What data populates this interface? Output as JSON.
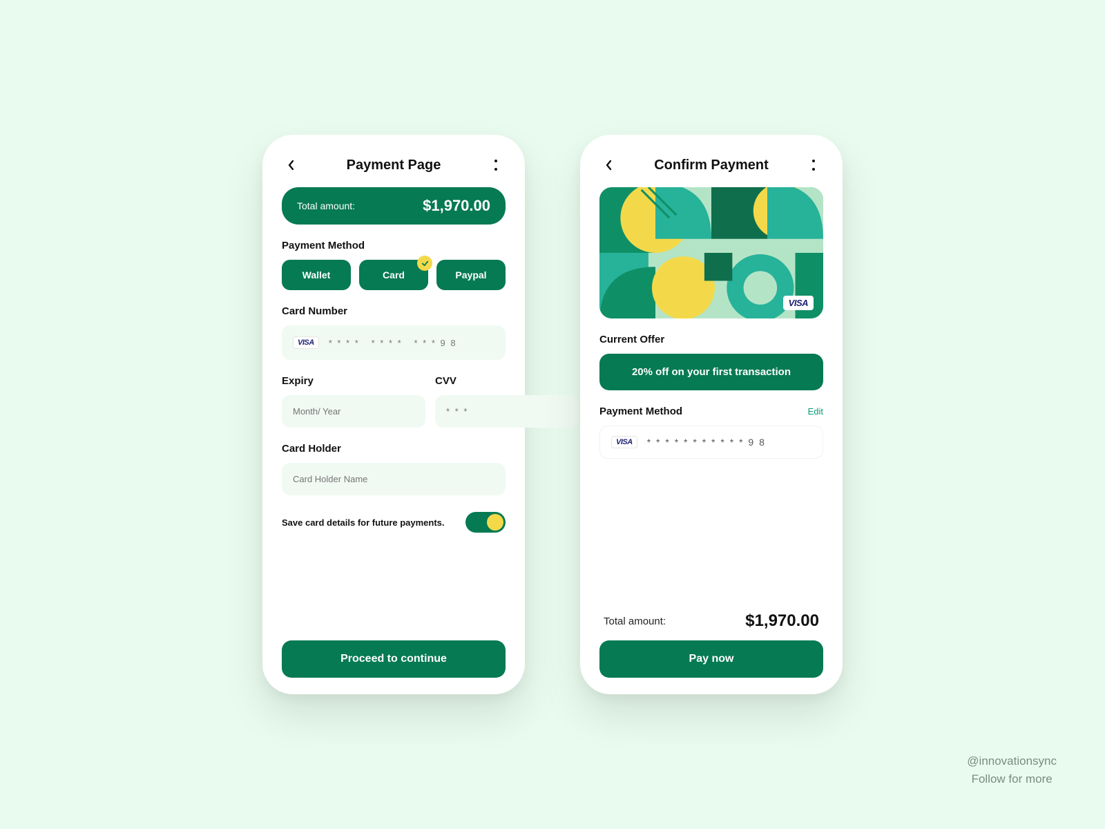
{
  "colors": {
    "primary": "#067a52",
    "accent": "#f3d94a",
    "bg": "#e9fbee"
  },
  "screen1": {
    "title": "Payment Page",
    "total_label": "Total amount:",
    "total_value": "$1,970.00",
    "payment_method_label": "Payment Method",
    "methods": {
      "wallet": "Wallet",
      "card": "Card",
      "paypal": "Paypal"
    },
    "card_brand": "VISA",
    "card_number_label": "Card Number",
    "card_number_masked": "* * * *   * * * *   * * * 9 8",
    "expiry_label": "Expiry",
    "expiry_placeholder": "Month/ Year",
    "cvv_label": "CVV",
    "cvv_placeholder": "* * *",
    "holder_label": "Card Holder",
    "holder_placeholder": "Card Holder Name",
    "save_toggle_label": "Save card details for future payments.",
    "save_toggle_on": true,
    "cta": "Proceed to continue"
  },
  "screen2": {
    "title": "Confirm Payment",
    "card_brand": "VISA",
    "current_offer_label": "Current Offer",
    "offer_text": "20% off on your first transaction",
    "payment_method_label": "Payment Method",
    "edit_label": "Edit",
    "card_number_masked": "* * * *   * * * *   * * * 9 8",
    "total_label": "Total amount:",
    "total_value": "$1,970.00",
    "cta": "Pay now"
  },
  "footer": {
    "handle": "@innovationsync",
    "tagline": "Follow for more"
  }
}
